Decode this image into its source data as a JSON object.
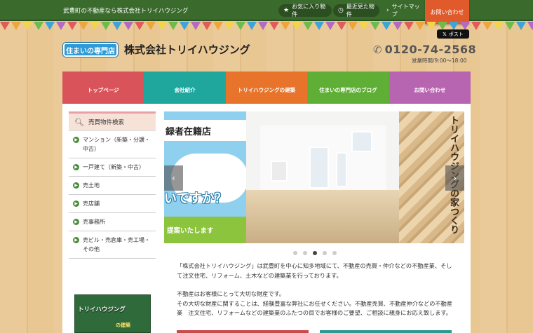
{
  "header": {
    "tagline": "武豊町の不動産なら株式会社トリイハウジング",
    "links": [
      {
        "label": "お気に入り物件",
        "icon": "star-icon"
      },
      {
        "label": "最近見た物件",
        "icon": "history-icon"
      },
      {
        "label": "サイトマップ",
        "icon": "chevron-right-icon"
      }
    ],
    "contact_tab": "お問い合わせ",
    "x_post": "ポスト",
    "logo_text": "住まいの専門店",
    "company_name": "株式会社トリイハウジング",
    "phone": "0120-74-2568",
    "hours": "営業時間/9:00～18:00"
  },
  "nav": {
    "items": [
      {
        "label": "トップページ",
        "color": "#d9545a"
      },
      {
        "label": "会社紹介",
        "color": "#1fa79e"
      },
      {
        "label": "トリイハウジングの建築",
        "color": "#e7742a"
      },
      {
        "label": "住まいの専門店のブログ",
        "color": "#5fae35"
      },
      {
        "label": "お問い合わせ",
        "color": "#b765b0"
      }
    ]
  },
  "sidebar": {
    "title": "売買物件検索",
    "items": [
      {
        "label": "マンション（新築・分譲・中古）"
      },
      {
        "label": "一戸建て（新築・中古）"
      },
      {
        "label": "売土地"
      },
      {
        "label": "売店舗"
      },
      {
        "label": "売事務所"
      },
      {
        "label": "売ビル・売倉庫・売工場・その他"
      }
    ],
    "banner_text": "トリイハウジング",
    "banner_sub": "の建築"
  },
  "slider": {
    "left_band": "録者在籍店",
    "left_question": "いですか？",
    "left_green": "提案いたします",
    "right_text": "トリイハウジングの家つくり",
    "prev": "‹",
    "next": "›",
    "active_dot": 2,
    "dot_count": 5
  },
  "intro": {
    "p1": "「株式会社トリイハウジング」は武豊町を中心に知多地域にて、不動産の売買・仲介などの不動産業、そして注文住宅、リフォーム、土木などの建築業を行っております。",
    "p2": "不動産はお客様にとって大切な財産です。",
    "p3": "その大切な財産に関することは、経験豊富な弊社にお任せください。不動産売買、不動産仲介などの不動産業　注文住宅、リフォームなどの建築業のふたつの目でお客様のご要望、ご相談に親身にお応え致します。"
  }
}
